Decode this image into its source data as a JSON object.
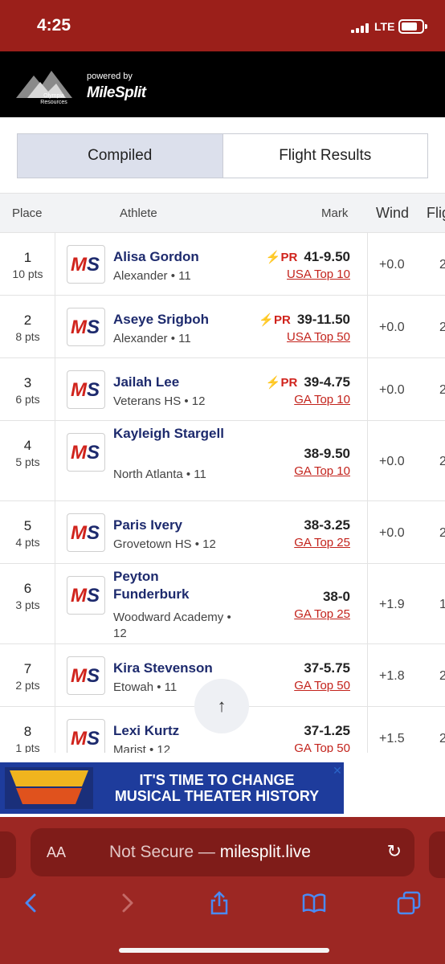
{
  "status": {
    "time": "4:25",
    "network": "LTE"
  },
  "brand": {
    "logo_text": "Olympia Resources",
    "powered_by": "powered by",
    "name": "MileSplit"
  },
  "tabs": [
    {
      "label": "Compiled",
      "active": true
    },
    {
      "label": "Flight Results",
      "active": false
    }
  ],
  "table": {
    "headers": {
      "place": "Place",
      "athlete": "Athlete",
      "mark": "Mark",
      "wind": "Wind",
      "flight": "Flig"
    },
    "rows": [
      {
        "place": "1",
        "pts": "10 pts",
        "name": "Alisa Gordon",
        "sub": "Alexander • 11",
        "pr": "PR",
        "mark": "41-9.50",
        "rank": "USA Top 10",
        "wind": "+0.0",
        "flight": "2"
      },
      {
        "place": "2",
        "pts": "8 pts",
        "name": "Aseye Srigboh",
        "sub": "Alexander • 11",
        "pr": "PR",
        "mark": "39-11.50",
        "rank": "USA Top 50",
        "wind": "+0.0",
        "flight": "2"
      },
      {
        "place": "3",
        "pts": "6 pts",
        "name": "Jailah Lee",
        "sub": "Veterans HS • 12",
        "pr": "PR",
        "mark": "39-4.75",
        "rank": "GA Top 10",
        "wind": "+0.0",
        "flight": "2"
      },
      {
        "place": "4",
        "pts": "5 pts",
        "name": "Kayleigh Stargell",
        "sub": "North Atlanta • 11",
        "pr": "",
        "mark": "38-9.50",
        "rank": "GA Top 10",
        "wind": "+0.0",
        "flight": "2"
      },
      {
        "place": "5",
        "pts": "4 pts",
        "name": "Paris Ivery",
        "sub": "Grovetown HS • 12",
        "pr": "",
        "mark": "38-3.25",
        "rank": "GA Top 25",
        "wind": "+0.0",
        "flight": "2"
      },
      {
        "place": "6",
        "pts": "3 pts",
        "name": "Peyton Funderburk",
        "sub": "Woodward Academy • 12",
        "pr": "",
        "mark": "38-0",
        "rank": "GA Top 25",
        "wind": "+1.9",
        "flight": "1"
      },
      {
        "place": "7",
        "pts": "2 pts",
        "name": "Kira Stevenson",
        "sub": "Etowah • 11",
        "pr": "",
        "mark": "37-5.75",
        "rank": "GA Top 50",
        "wind": "+1.8",
        "flight": "2"
      },
      {
        "place": "8",
        "pts": "1 pts",
        "name": "Lexi Kurtz",
        "sub": "Marist • 12",
        "pr": "",
        "mark": "37-1.25",
        "rank": "GA Top 50",
        "wind": "+1.5",
        "flight": "2"
      }
    ]
  },
  "scroll_top": {
    "glyph": "↑"
  },
  "ad": {
    "logo_text": "BACK TO THE FUTURE THE MUSICAL",
    "line1": "IT'S TIME TO CHANGE",
    "line2": "MUSICAL THEATER HISTORY",
    "close": "✕"
  },
  "browser": {
    "aa": "AA",
    "url_prefix": "Not Secure — ",
    "url_host": "milesplit.live",
    "reload": "↻",
    "icons": [
      "back-icon",
      "forward-icon",
      "share-icon",
      "bookmarks-icon",
      "tabs-icon"
    ]
  },
  "colors": {
    "status_bg": "#9b1f1a",
    "browser_bg": "#9c2723",
    "athlete_name": "#1d2a6d",
    "accent_red": "#d0231c",
    "tab_active": "#dce0ec"
  }
}
